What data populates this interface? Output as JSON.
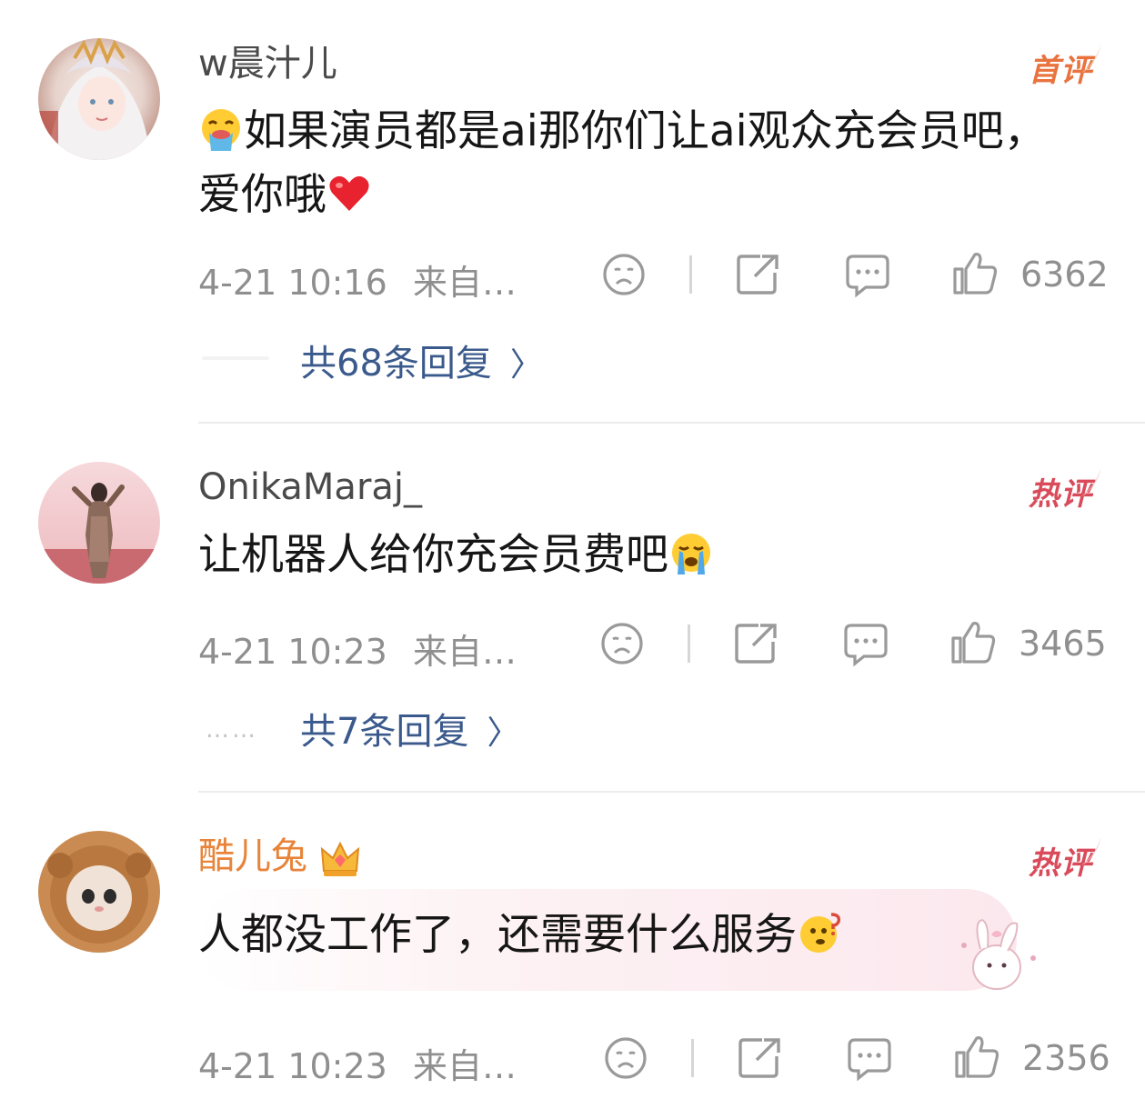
{
  "comments": [
    {
      "username": "w晨汁儿",
      "badge": "首评",
      "text": "如果演员都是ai那你们让ai观众充会员吧，爱你哦",
      "lead_emoji": "puke-face-emoji",
      "trail_emoji": "red-heart-emoji",
      "time": "4-21 10:16",
      "source": "来自…",
      "likes": "6362",
      "replies": "共68条回复"
    },
    {
      "username": "OnikaMaraj_",
      "badge": "热评",
      "text": "让机器人给你充会员费吧",
      "trail_emoji": "crying-face-emoji",
      "time": "4-21 10:23",
      "source": "来自…",
      "likes": "3465",
      "replies": "共7条回复",
      "dots": "……"
    },
    {
      "username": "酷儿兔",
      "badge": "热评",
      "vip_icon": "crown-icon",
      "text": "人都没工作了，还需要什么服务",
      "trail_emoji": "thinking-face-emoji",
      "time": "4-21 10:23",
      "source": "来自…",
      "likes": "2356"
    }
  ],
  "colors": {
    "reply_link": "#3b5a8c",
    "meta_gray": "#8f8f8f",
    "first_badge": "#e9733f",
    "hot_badge": "#d94b5a",
    "vip_name": "#e8843a"
  }
}
